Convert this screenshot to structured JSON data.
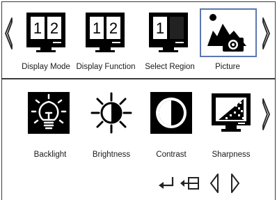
{
  "top_menu": {
    "items": [
      {
        "label": "Display Mode",
        "icon": "dual-screen-1-2-icon"
      },
      {
        "label": "Display Function",
        "icon": "dual-screen-1-2-icon"
      },
      {
        "label": "Select Region",
        "icon": "region-select-icon"
      },
      {
        "label": "Picture",
        "icon": "picture-camera-icon"
      }
    ],
    "selected": "Picture"
  },
  "sub_menu": {
    "items": [
      {
        "label": "Backlight",
        "icon": "lightbulb-icon"
      },
      {
        "label": "Brightness",
        "icon": "sun-icon"
      },
      {
        "label": "Contrast",
        "icon": "contrast-icon"
      },
      {
        "label": "Sharpness",
        "icon": "sharpness-icon"
      }
    ]
  },
  "digits": {
    "one": "1",
    "two": "2"
  },
  "colors": {
    "accent": "#5b78b0",
    "icon": "#000000"
  }
}
